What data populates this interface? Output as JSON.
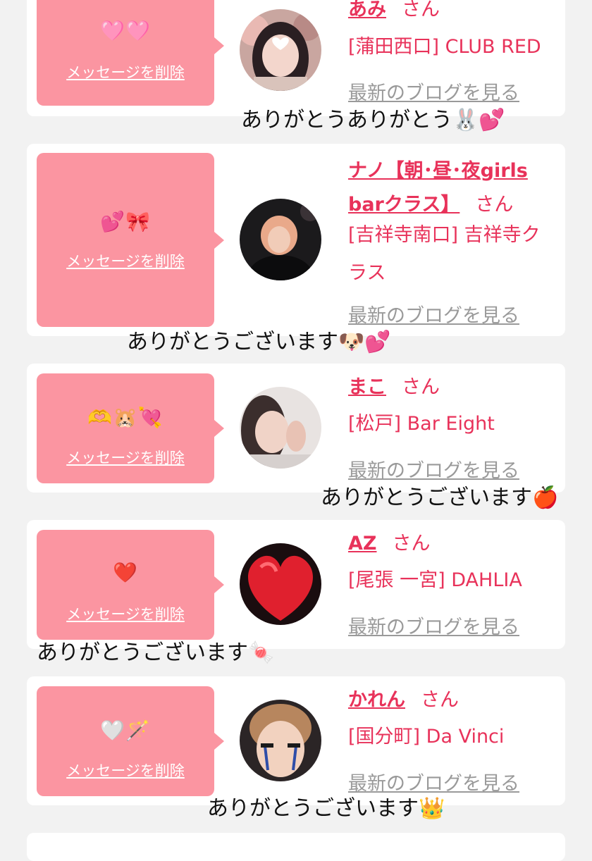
{
  "common": {
    "delete_label": "メッセージを削除",
    "san_label": "さん",
    "blog_label": "最新のブログを見る"
  },
  "cards": [
    {
      "stamp": "🩷🩷",
      "name": "あみ",
      "shop": "[蒲田西口] CLUB RED",
      "thanks": "ありがとうありがとう🐰💕"
    },
    {
      "stamp": "💕🎀",
      "name": "ナノ【朝･昼･夜girls barクラス】",
      "shop": "[吉祥寺南口] 吉祥寺クラス",
      "thanks": "ありがとうございます🐶💕"
    },
    {
      "stamp": "🫶🐹💘",
      "name": "まこ",
      "shop": "[松戸] Bar Eight",
      "thanks": "ありがとうございます🍎"
    },
    {
      "stamp": "❤️",
      "name": "AZ",
      "shop": "[尾張 一宮] DAHLIA",
      "thanks": "ありがとうございます🍬"
    },
    {
      "stamp": "🤍🪄",
      "name": "かれん",
      "shop": "[国分町] Da Vinci",
      "thanks": "ありがとうございます👑"
    }
  ]
}
